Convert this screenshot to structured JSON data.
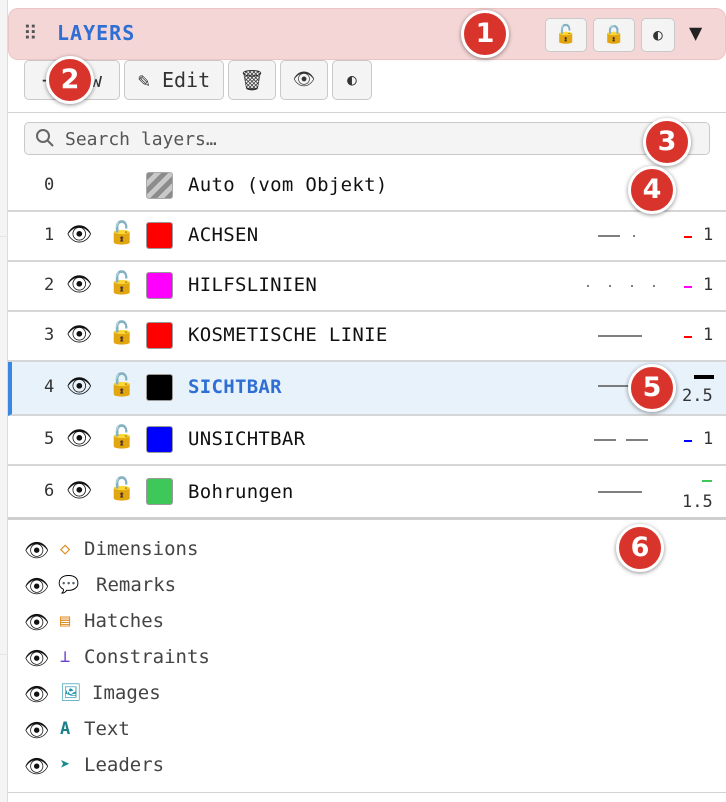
{
  "header": {
    "title": "LAYERS",
    "grip_icon": "grip-icon",
    "buttons": [
      "unlock-all-icon",
      "lock-all-icon",
      "contrast-icon"
    ],
    "collapse_icon": "collapse-icon"
  },
  "toolbar": {
    "new_label": "+ New",
    "edit_label": "✎ Edit",
    "delete_icon": "trash-icon",
    "visibility_icon": "eye-icon",
    "contrast_icon": "contrast-icon"
  },
  "search": {
    "placeholder": "Search layers…"
  },
  "layers": [
    {
      "index": "0",
      "name": "Auto (vom Objekt)",
      "color": "auto",
      "visible": null,
      "locked": null,
      "linetype": null,
      "lineweight": null
    },
    {
      "index": "1",
      "name": "ACHSEN",
      "color": "#ff0000",
      "linetype": "dash-dot",
      "lineweight": "1"
    },
    {
      "index": "2",
      "name": "HILFSLINIEN",
      "color": "#ff00ff",
      "linetype": "dotted",
      "lineweight": "1"
    },
    {
      "index": "3",
      "name": "KOSMETISCHE LINIE",
      "color": "#ff0000",
      "linetype": "solid",
      "lineweight": "1"
    },
    {
      "index": "4",
      "name": "SICHTBAR",
      "color": "#000000",
      "linetype": "solid",
      "lineweight": "2.5",
      "selected": true
    },
    {
      "index": "5",
      "name": "UNSICHTBAR",
      "color": "#0000ff",
      "linetype": "dashed",
      "lineweight": "1"
    },
    {
      "index": "6",
      "name": "Bohrungen",
      "color": "#3ec85a",
      "linetype": "solid",
      "lineweight": "1.5"
    }
  ],
  "annotation_types": [
    {
      "icon": "diamond-icon",
      "label": "Dimensions"
    },
    {
      "icon": "speech-bubble-icon",
      "label": "Remarks"
    },
    {
      "icon": "hatch-icon",
      "label": "Hatches"
    },
    {
      "icon": "perpendicular-icon",
      "label": "Constraints"
    },
    {
      "icon": "image-icon",
      "label": "Images"
    },
    {
      "icon": "text-icon",
      "label": "Text"
    },
    {
      "icon": "arrow-icon",
      "label": "Leaders"
    }
  ],
  "callouts": [
    "1",
    "2",
    "3",
    "4",
    "5",
    "6"
  ],
  "colors": {
    "accent": "#2f6fd4",
    "header_bg": "#f5d6d6",
    "callout": "#d9342b",
    "lock": "#d9a020"
  }
}
